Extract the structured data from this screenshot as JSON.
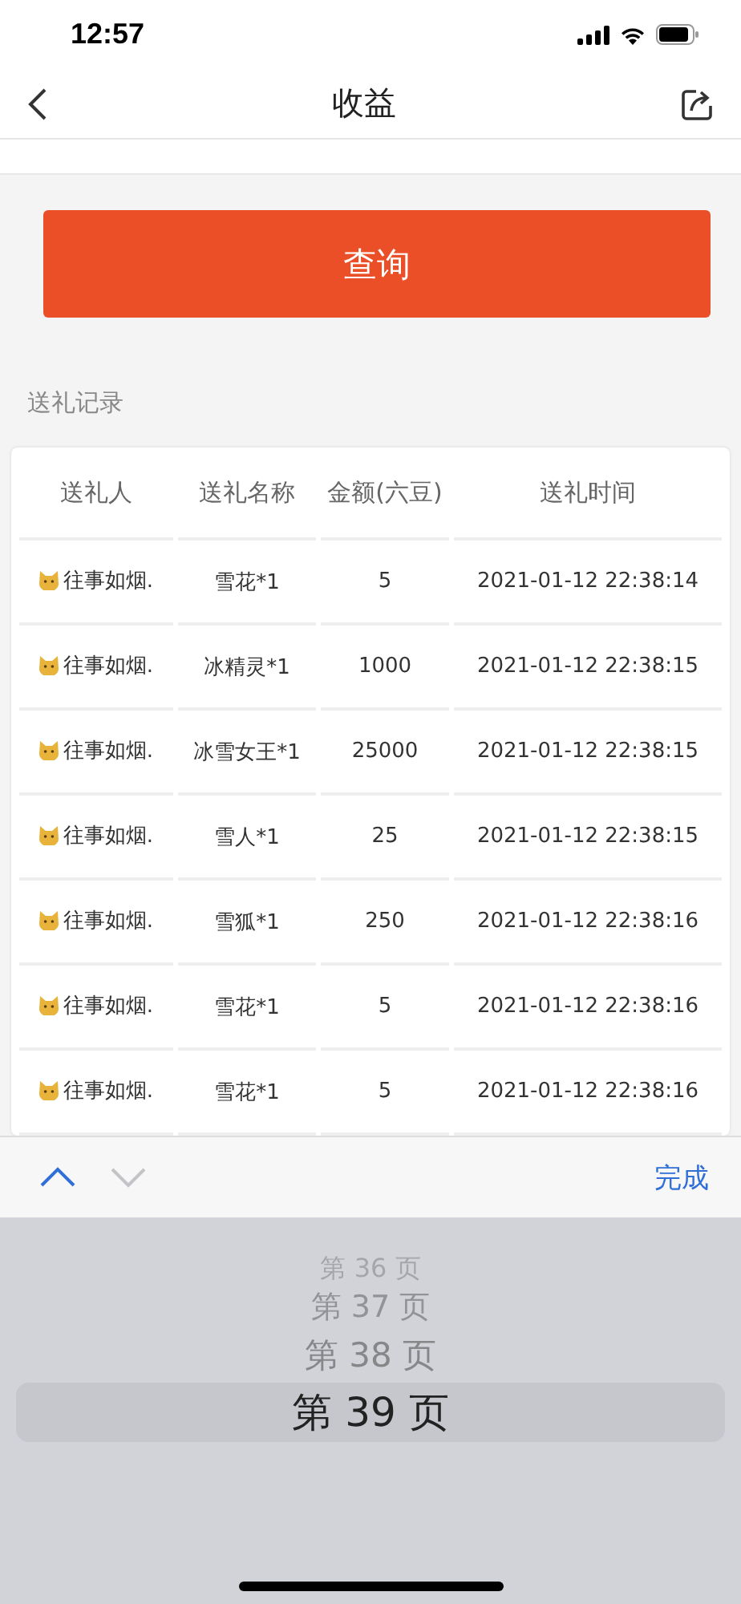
{
  "status_bar": {
    "time": "12:57"
  },
  "nav": {
    "title": "收益"
  },
  "query_button": "查询",
  "section_title": "送礼记录",
  "table": {
    "columns": [
      "送礼人",
      "送礼名称",
      "金额(六豆)",
      "送礼时间"
    ],
    "rows": [
      {
        "sender": "往事如烟.",
        "gift": "雪花*1",
        "amount": "5",
        "time": "2021-01-12 22:38:14"
      },
      {
        "sender": "往事如烟.",
        "gift": "冰精灵*1",
        "amount": "1000",
        "time": "2021-01-12 22:38:15"
      },
      {
        "sender": "往事如烟.",
        "gift": "冰雪女王*1",
        "amount": "25000",
        "time": "2021-01-12 22:38:15"
      },
      {
        "sender": "往事如烟.",
        "gift": "雪人*1",
        "amount": "25",
        "time": "2021-01-12 22:38:15"
      },
      {
        "sender": "往事如烟.",
        "gift": "雪狐*1",
        "amount": "250",
        "time": "2021-01-12 22:38:16"
      },
      {
        "sender": "往事如烟.",
        "gift": "雪花*1",
        "amount": "5",
        "time": "2021-01-12 22:38:16"
      },
      {
        "sender": "往事如烟.",
        "gift": "雪花*1",
        "amount": "5",
        "time": "2021-01-12 22:38:16"
      }
    ]
  },
  "toolbar": {
    "prev_disabled": false,
    "next_disabled": true,
    "done": "完成"
  },
  "picker": [
    {
      "label": "第 36 页",
      "selected": false
    },
    {
      "label": "第 37 页",
      "selected": false
    },
    {
      "label": "第 38 页",
      "selected": false
    },
    {
      "label": "第 39 页",
      "selected": true
    }
  ]
}
